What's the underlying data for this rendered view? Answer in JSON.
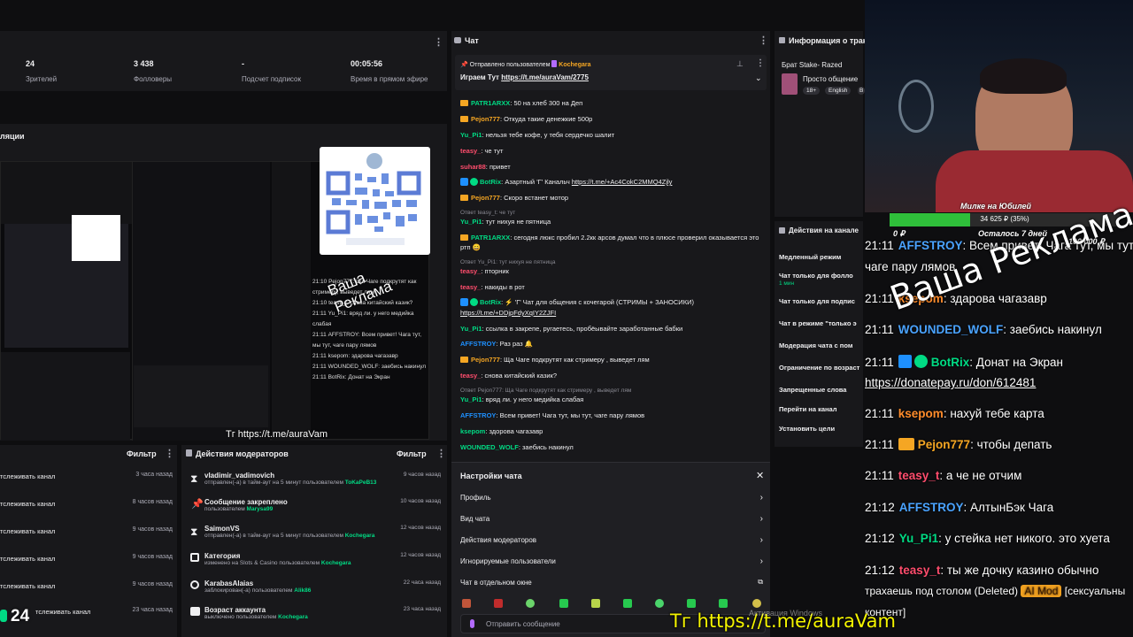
{
  "stats": [
    {
      "value": "24",
      "label": "Зрителей"
    },
    {
      "value": "3 438",
      "label": "Фолловеры"
    },
    {
      "value": "-",
      "label": "Подсчет подписок"
    },
    {
      "value": "00:05:56",
      "label": "Время в прямом эфире"
    }
  ],
  "preview_label": "ляции",
  "chat": {
    "title": "Чат",
    "pinned_by": "Отправлено пользователем",
    "pinned_user": "Kochegara",
    "pinned_text": "Играем Тут",
    "pinned_link": "https://t.me/auraVam/2775",
    "input_placeholder": "Отправить сообщение",
    "messages": [
      {
        "user": "PATR1ARXX",
        "color": "#00db84",
        "text": ": 50 на хлеб 300 на Деп"
      },
      {
        "user": "Pejon777",
        "color": "#f5a623",
        "text": ": Откуда такие денежкие 500р"
      },
      {
        "user": "Yu_Pi1",
        "color": "#00db84",
        "text": ": нельзя тебе кофе, у тебя сердечко шалит"
      },
      {
        "user": "teasy_",
        "color": "#ff4d6d",
        "text": ": че тут"
      },
      {
        "user": "suhar88",
        "color": "#ff4d6d",
        "text": ": привет"
      },
      {
        "user": "BotRix",
        "color": "#00db84",
        "text": ": Азартный 'Г' Канальч",
        "link": "https://t.me/+Ac4CokC2MMQ4Zjly"
      },
      {
        "user": "Pejon777",
        "color": "#f5a623",
        "text": ": Скоро встанет мотор"
      },
      {
        "reply": "Ответ teasy_t: че тут"
      },
      {
        "user": "Yu_Pi1",
        "color": "#00db84",
        "text": ": тут нихуя не пятница"
      },
      {
        "user": "PATR1ARXX",
        "color": "#00db84",
        "text": ": сегодня люкс пробил 2.2кк арсов думал что в плюсе проверил оказывается это"
      },
      {
        "text": "ртп 😄"
      },
      {
        "reply": "Ответ Yu_Pi1: тут нихуя не пятница"
      },
      {
        "user": "teasy_",
        "color": "#ff4d6d",
        "text": ": пторник"
      },
      {
        "user": "teasy_",
        "color": "#ff4d6d",
        "text": ": накиды в рот"
      },
      {
        "user": "BotRix",
        "color": "#00db84",
        "text": ": ⚡ 'Г' Чат для общения с кочегарой (СТРИМЫ + ЗАНОСИКИ)"
      },
      {
        "link": "https://t.me/+DDjpFdyXqIY2ZJFI"
      },
      {
        "user": "Yu_Pi1",
        "color": "#00db84",
        "text": ": ссылка в закрепе, ругаетесь, пробёывайте заработанные бабки"
      },
      {
        "user": "AFFSTROY",
        "color": "#1e90ff",
        "text": ": Раз раз 🔔"
      },
      {
        "user": "Pejon777",
        "color": "#f5a623",
        "text": ": Ща Чаге подкрутят как стримеру , выведет лям"
      },
      {
        "user": "teasy_",
        "color": "#ff4d6d",
        "text": ": снова китайский казик?"
      },
      {
        "reply": "Ответ Pejon777: Ща Чаге подкрутят как стримеру , выведет лям"
      },
      {
        "user": "Yu_Pi1",
        "color": "#00db84",
        "text": ": вряд ли. у него медийка слабая"
      },
      {
        "user": "AFFSTROY",
        "color": "#1e90ff",
        "text": ": Всем привет! Чага тут, мы тут, чаге пару лямов"
      },
      {
        "user": "ksepom",
        "color": "#00db84",
        "text": ": здорова чагазавр"
      },
      {
        "user": "WOUNDED_WOLF",
        "color": "#00db84",
        "text": ": заебись накинул"
      }
    ]
  },
  "chat_settings": {
    "title": "Настройки чата",
    "items": [
      "Профиль",
      "Вид чата",
      "Действия модераторов",
      "Игнорируемые пользователи",
      "Чат в отдельном окне"
    ]
  },
  "stream_info": {
    "title": "Информация о трансл",
    "name": "Брат Stake- Razed",
    "category": "Просто общение",
    "tags": [
      "18+",
      "English",
      "B"
    ]
  },
  "channel_actions": {
    "title": "Действия на канале",
    "items": [
      "Медленный режим",
      "Чат только для фолло",
      "1 мин",
      "Чат только для подпис",
      "Чат в режиме \"только э",
      "Модерация чата с пом",
      "Ограничение по возраст",
      "Запрещенные слова",
      "Перейти на канал",
      "Установить цели"
    ]
  },
  "mod_actions": {
    "title": "Действия модераторов",
    "filter": "Фильтр",
    "rows": [
      {
        "title": "vladimir_vadimovich",
        "sub": "отправлен(-а) в тайм-аут на 5 минут пользователем",
        "who": "ToKaPeB13",
        "time": "9 часов назад",
        "icon": "hourglass-icon"
      },
      {
        "title": "Сообщение закреплено",
        "sub": "пользователем",
        "who": "Marysa99",
        "time": "10 часов назад",
        "icon": "pin-icon"
      },
      {
        "title": "SaimonVS",
        "sub": "отправлен(-а) в тайм-аут на 5 минут пользователем",
        "who": "Kochegara",
        "time": "12 часов назад",
        "icon": "hourglass-icon"
      },
      {
        "title": "Категория",
        "sub": "изменено на Slots & Casino пользователем",
        "who": "Kochegara",
        "time": "12 часов назад",
        "icon": "category-icon"
      },
      {
        "title": "KarabasAlaias",
        "sub": "заблокирован(-а) пользователем",
        "who": "Alik86",
        "time": "22 часа назад",
        "icon": "ban-icon"
      },
      {
        "title": "Возраст аккаунта",
        "sub": "выключено пользователем",
        "who": "Kochegara",
        "time": "23 часа назад",
        "icon": "account-icon"
      }
    ]
  },
  "activity": {
    "filter": "Фильтр",
    "rows": [
      {
        "text": "тслеживать канал",
        "time": "3 часа назад"
      },
      {
        "text": "тслеживать канал",
        "time": "8 часов назад"
      },
      {
        "text": "тслеживать канал",
        "time": "9 часов назад"
      },
      {
        "text": "тслеживать канал",
        "time": "9 часов назад"
      },
      {
        "text": "тслеживать канал",
        "time": "9 часов назад"
      },
      {
        "text": "тслеживать канал",
        "time": "23 часа назад"
      }
    ]
  },
  "overlay": {
    "goal_title": "Милке на Юбилей",
    "goal_amount": "34 625 ₽ (35%)",
    "goal_progress": 0.35,
    "goal_min": "0 ₽",
    "goal_left": "Осталось 7 дней",
    "goal_max": "100 000 ₽",
    "ad_text": "Ваша Реклама",
    "tg_link": "Тг https://t.me/auraVam",
    "viewer_count": "24",
    "windows_watermark": "Активация Windows",
    "chat": [
      {
        "time": "21:11",
        "user": "AFFSTROY",
        "color": "#4aa3ff",
        "text": ": Всем привет! Чага тут, мы тут,"
      },
      {
        "text": "чаге пару лямов"
      },
      {
        "time": "21:11",
        "user": "ksepom",
        "color": "#ff8c2b",
        "text": ": здарова чагазавр"
      },
      {
        "time": "21:11",
        "user": "WOUNDED_WOLF",
        "color": "#4aa3ff",
        "text": ": заебись накинул"
      },
      {
        "time": "21:11",
        "user": "BotRix",
        "color": "#00db84",
        "text": ": Донат на Экран"
      },
      {
        "link": "https://donatepay.ru/don/612481"
      },
      {
        "time": "21:11",
        "user": "ksepom",
        "color": "#ff8c2b",
        "text": ": нахуй тебе карта"
      },
      {
        "time": "21:11",
        "user": "Pejon777",
        "color": "#f5a623",
        "text": ": чтобы депать"
      },
      {
        "time": "21:11",
        "user": "teasy_t",
        "color": "#ff4d6d",
        "text": ": а че не отчим"
      },
      {
        "time": "21:12",
        "user": "AFFSTROY",
        "color": "#4aa3ff",
        "text": ": АлтынБэк Чага"
      },
      {
        "time": "21:12",
        "user": "Yu_Pi1",
        "color": "#00db84",
        "text": ": у стейка нет никого. это хуета"
      },
      {
        "time": "21:12",
        "user": "teasy_t",
        "color": "#ff4d6d",
        "text": ": ты же дочку казино обычно"
      },
      {
        "text": "трахаешь под столом (Deleted)",
        "badge": "AI Mod",
        "tail": "[сексуальны"
      },
      {
        "text": "контент]"
      }
    ]
  }
}
